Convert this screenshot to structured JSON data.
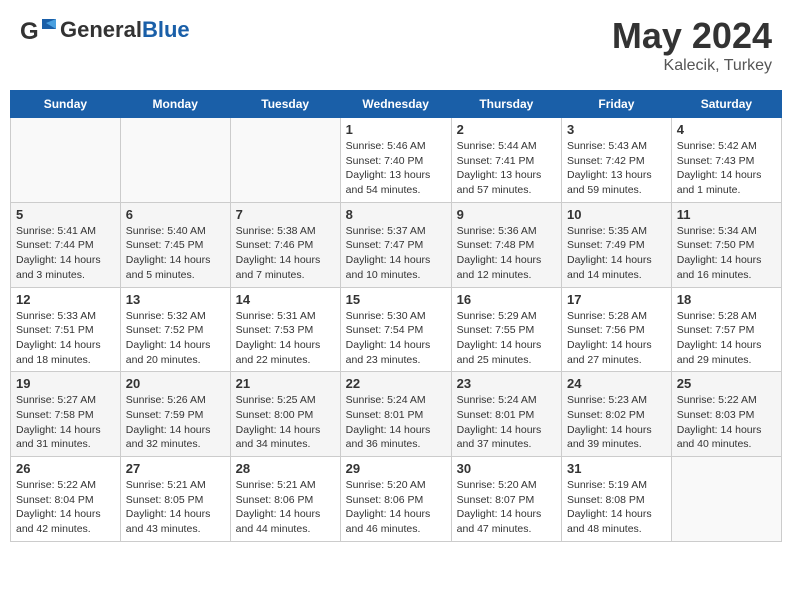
{
  "header": {
    "logo_general": "General",
    "logo_blue": "Blue",
    "month": "May 2024",
    "location": "Kalecik, Turkey"
  },
  "days_of_week": [
    "Sunday",
    "Monday",
    "Tuesday",
    "Wednesday",
    "Thursday",
    "Friday",
    "Saturday"
  ],
  "weeks": [
    [
      {
        "day": "",
        "info": ""
      },
      {
        "day": "",
        "info": ""
      },
      {
        "day": "",
        "info": ""
      },
      {
        "day": "1",
        "info": "Sunrise: 5:46 AM\nSunset: 7:40 PM\nDaylight: 13 hours\nand 54 minutes."
      },
      {
        "day": "2",
        "info": "Sunrise: 5:44 AM\nSunset: 7:41 PM\nDaylight: 13 hours\nand 57 minutes."
      },
      {
        "day": "3",
        "info": "Sunrise: 5:43 AM\nSunset: 7:42 PM\nDaylight: 13 hours\nand 59 minutes."
      },
      {
        "day": "4",
        "info": "Sunrise: 5:42 AM\nSunset: 7:43 PM\nDaylight: 14 hours\nand 1 minute."
      }
    ],
    [
      {
        "day": "5",
        "info": "Sunrise: 5:41 AM\nSunset: 7:44 PM\nDaylight: 14 hours\nand 3 minutes."
      },
      {
        "day": "6",
        "info": "Sunrise: 5:40 AM\nSunset: 7:45 PM\nDaylight: 14 hours\nand 5 minutes."
      },
      {
        "day": "7",
        "info": "Sunrise: 5:38 AM\nSunset: 7:46 PM\nDaylight: 14 hours\nand 7 minutes."
      },
      {
        "day": "8",
        "info": "Sunrise: 5:37 AM\nSunset: 7:47 PM\nDaylight: 14 hours\nand 10 minutes."
      },
      {
        "day": "9",
        "info": "Sunrise: 5:36 AM\nSunset: 7:48 PM\nDaylight: 14 hours\nand 12 minutes."
      },
      {
        "day": "10",
        "info": "Sunrise: 5:35 AM\nSunset: 7:49 PM\nDaylight: 14 hours\nand 14 minutes."
      },
      {
        "day": "11",
        "info": "Sunrise: 5:34 AM\nSunset: 7:50 PM\nDaylight: 14 hours\nand 16 minutes."
      }
    ],
    [
      {
        "day": "12",
        "info": "Sunrise: 5:33 AM\nSunset: 7:51 PM\nDaylight: 14 hours\nand 18 minutes."
      },
      {
        "day": "13",
        "info": "Sunrise: 5:32 AM\nSunset: 7:52 PM\nDaylight: 14 hours\nand 20 minutes."
      },
      {
        "day": "14",
        "info": "Sunrise: 5:31 AM\nSunset: 7:53 PM\nDaylight: 14 hours\nand 22 minutes."
      },
      {
        "day": "15",
        "info": "Sunrise: 5:30 AM\nSunset: 7:54 PM\nDaylight: 14 hours\nand 23 minutes."
      },
      {
        "day": "16",
        "info": "Sunrise: 5:29 AM\nSunset: 7:55 PM\nDaylight: 14 hours\nand 25 minutes."
      },
      {
        "day": "17",
        "info": "Sunrise: 5:28 AM\nSunset: 7:56 PM\nDaylight: 14 hours\nand 27 minutes."
      },
      {
        "day": "18",
        "info": "Sunrise: 5:28 AM\nSunset: 7:57 PM\nDaylight: 14 hours\nand 29 minutes."
      }
    ],
    [
      {
        "day": "19",
        "info": "Sunrise: 5:27 AM\nSunset: 7:58 PM\nDaylight: 14 hours\nand 31 minutes."
      },
      {
        "day": "20",
        "info": "Sunrise: 5:26 AM\nSunset: 7:59 PM\nDaylight: 14 hours\nand 32 minutes."
      },
      {
        "day": "21",
        "info": "Sunrise: 5:25 AM\nSunset: 8:00 PM\nDaylight: 14 hours\nand 34 minutes."
      },
      {
        "day": "22",
        "info": "Sunrise: 5:24 AM\nSunset: 8:01 PM\nDaylight: 14 hours\nand 36 minutes."
      },
      {
        "day": "23",
        "info": "Sunrise: 5:24 AM\nSunset: 8:01 PM\nDaylight: 14 hours\nand 37 minutes."
      },
      {
        "day": "24",
        "info": "Sunrise: 5:23 AM\nSunset: 8:02 PM\nDaylight: 14 hours\nand 39 minutes."
      },
      {
        "day": "25",
        "info": "Sunrise: 5:22 AM\nSunset: 8:03 PM\nDaylight: 14 hours\nand 40 minutes."
      }
    ],
    [
      {
        "day": "26",
        "info": "Sunrise: 5:22 AM\nSunset: 8:04 PM\nDaylight: 14 hours\nand 42 minutes."
      },
      {
        "day": "27",
        "info": "Sunrise: 5:21 AM\nSunset: 8:05 PM\nDaylight: 14 hours\nand 43 minutes."
      },
      {
        "day": "28",
        "info": "Sunrise: 5:21 AM\nSunset: 8:06 PM\nDaylight: 14 hours\nand 44 minutes."
      },
      {
        "day": "29",
        "info": "Sunrise: 5:20 AM\nSunset: 8:06 PM\nDaylight: 14 hours\nand 46 minutes."
      },
      {
        "day": "30",
        "info": "Sunrise: 5:20 AM\nSunset: 8:07 PM\nDaylight: 14 hours\nand 47 minutes."
      },
      {
        "day": "31",
        "info": "Sunrise: 5:19 AM\nSunset: 8:08 PM\nDaylight: 14 hours\nand 48 minutes."
      },
      {
        "day": "",
        "info": ""
      }
    ]
  ]
}
